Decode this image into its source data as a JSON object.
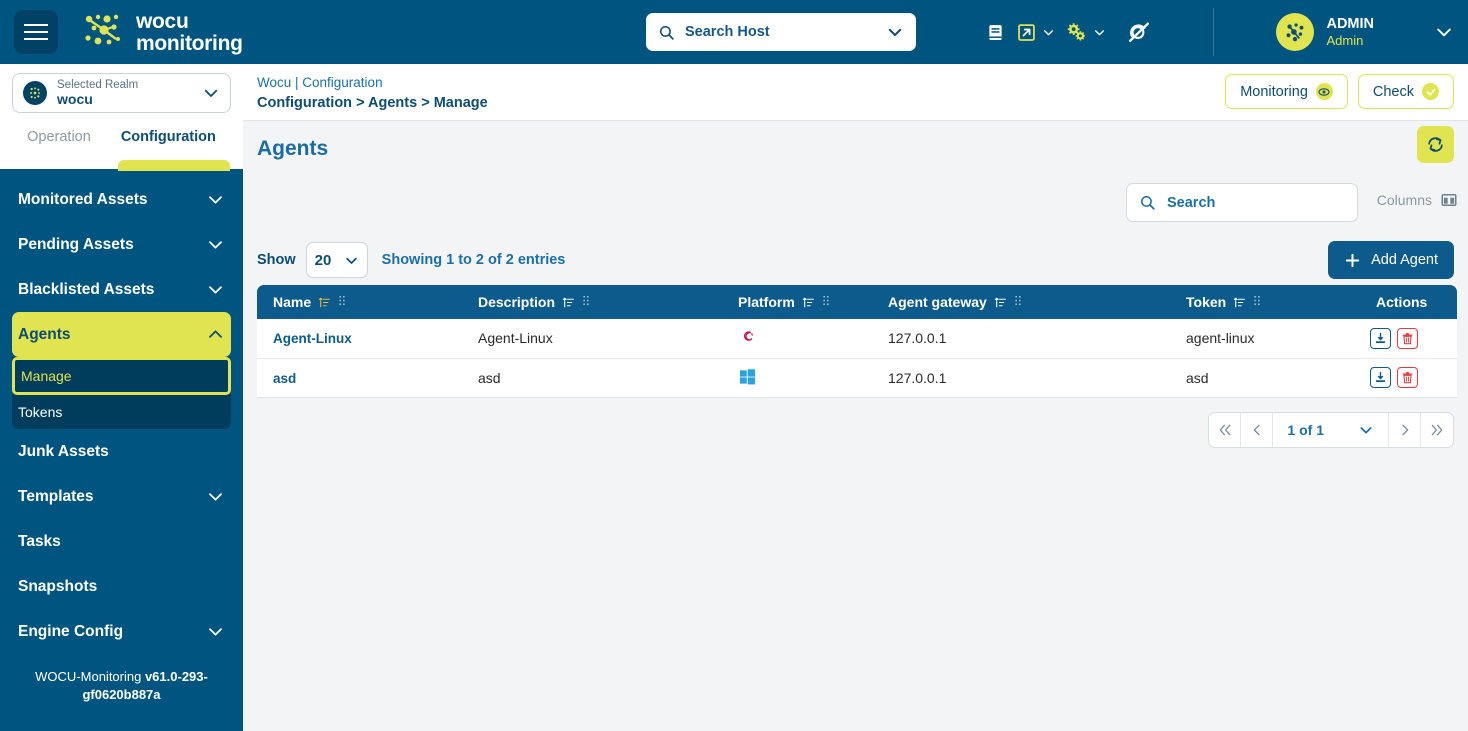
{
  "header": {
    "brand_line1": "wocu",
    "brand_line2": "monitoring",
    "host_search_placeholder": "Search Host",
    "icons": [
      "book-icon",
      "external-link-icon",
      "gears-icon",
      "no-notifications-icon"
    ],
    "user_name": "ADMIN",
    "user_role": "Admin"
  },
  "sidebar": {
    "realm_label": "Selected Realm",
    "realm_value": "wocu",
    "tabs": [
      {
        "label": "Operation",
        "active": false
      },
      {
        "label": "Configuration",
        "active": true
      }
    ],
    "items": [
      {
        "label": "Monitored Assets",
        "expandable": true,
        "selected": false
      },
      {
        "label": "Pending Assets",
        "expandable": true,
        "selected": false
      },
      {
        "label": "Blacklisted Assets",
        "expandable": true,
        "selected": false
      },
      {
        "label": "Agents",
        "expandable": true,
        "selected": true
      },
      {
        "label": "Junk Assets",
        "expandable": false,
        "selected": false
      },
      {
        "label": "Templates",
        "expandable": true,
        "selected": false
      },
      {
        "label": "Tasks",
        "expandable": false,
        "selected": false
      },
      {
        "label": "Snapshots",
        "expandable": false,
        "selected": false
      },
      {
        "label": "Engine Config",
        "expandable": true,
        "selected": false
      }
    ],
    "submenu": [
      {
        "label": "Manage",
        "current": true
      },
      {
        "label": "Tokens",
        "current": false
      }
    ],
    "version_prefix": "WOCU-Monitoring ",
    "version_value": "v61.0-293-gf0620b887a"
  },
  "breadcrumb": {
    "line1": "Wocu | Configuration",
    "line2": "Configuration > Agents > Manage",
    "monitoring_label": "Monitoring",
    "check_label": "Check"
  },
  "page": {
    "title": "Agents",
    "refresh_icon": "refresh-icon"
  },
  "toolbar": {
    "search_placeholder": "Search",
    "columns_label": "Columns",
    "show_label": "Show",
    "show_value": "20",
    "showing_text": "Showing 1 to 2 of 2 entries",
    "add_label": "Add Agent"
  },
  "table": {
    "columns": [
      {
        "label": "Name",
        "sortable": true,
        "sorted": true
      },
      {
        "label": "Description",
        "sortable": true,
        "sorted": false
      },
      {
        "label": "Platform",
        "sortable": true,
        "sorted": false
      },
      {
        "label": "Agent gateway",
        "sortable": true,
        "sorted": false
      },
      {
        "label": "Token",
        "sortable": true,
        "sorted": false
      },
      {
        "label": "Actions",
        "sortable": false,
        "sorted": false
      }
    ],
    "rows": [
      {
        "name": "Agent-Linux",
        "description": "Agent-Linux",
        "platform": "debian-icon",
        "gateway": "127.0.0.1",
        "token": "agent-linux"
      },
      {
        "name": "asd",
        "description": "asd",
        "platform": "windows-icon",
        "gateway": "127.0.0.1",
        "token": "asd"
      }
    ],
    "action_icons": [
      "download-icon",
      "delete-icon"
    ]
  },
  "pagination": {
    "first_icon": "chevron-double-left-icon",
    "prev_icon": "chevron-left-icon",
    "page_text": "1 of 1",
    "next_icon": "chevron-right-icon",
    "last_icon": "chevron-double-right-icon"
  },
  "colors": {
    "header_blue": "#005580",
    "accent_yellow": "#dfe450",
    "table_header": "#0d5a8c",
    "link_blue": "#1b6fa8",
    "danger_red": "#e53b3b",
    "submenu_dark": "#003c5c"
  }
}
